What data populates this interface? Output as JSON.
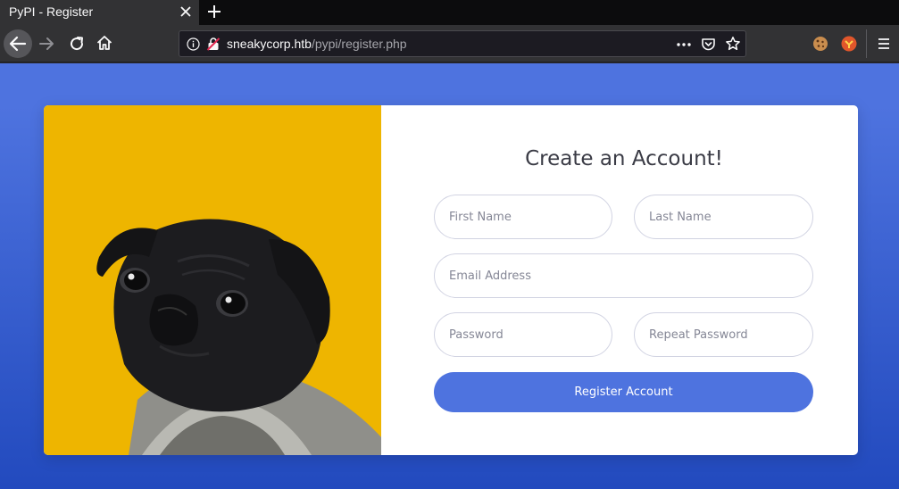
{
  "browser": {
    "tab": {
      "title": "PyPI - Register"
    },
    "url": {
      "host": "sneakycorp.htb",
      "path": "/pypi/register.php"
    },
    "icons": [
      "back-icon",
      "forward-icon",
      "reload-icon",
      "home-icon",
      "info-icon",
      "insecure-lock-icon",
      "more-actions-icon",
      "pocket-icon",
      "bookmark-star-icon",
      "cookie-extension-icon",
      "burp-extension-icon",
      "hamburger-menu-icon"
    ]
  },
  "register": {
    "title": "Create an Account!",
    "first_name_placeholder": "First Name",
    "last_name_placeholder": "Last Name",
    "email_placeholder": "Email Address",
    "password_placeholder": "Password",
    "repeat_password_placeholder": "Repeat Password",
    "submit_label": "Register Account"
  },
  "colors": {
    "primary": "#4e73df",
    "image_background": "#eeb500",
    "browser_chrome": "#323234"
  }
}
